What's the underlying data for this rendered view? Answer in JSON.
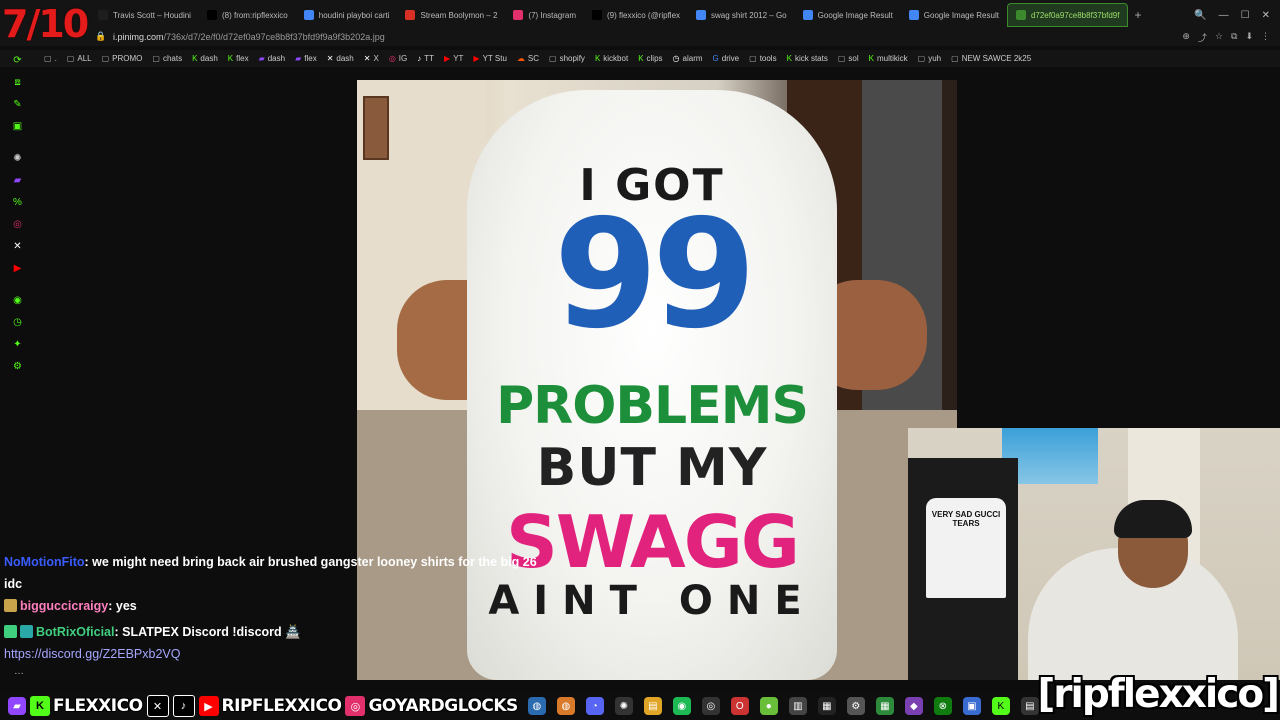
{
  "overlay": {
    "score": "7/10",
    "brand": "[ripflexxico]"
  },
  "tabs": [
    {
      "label": "Travis Scott – Houdini",
      "color": "#1e1e1e"
    },
    {
      "label": "(8) from:ripflexxico",
      "color": "#000000"
    },
    {
      "label": "houdini playboi carti",
      "color": "#4285f4"
    },
    {
      "label": "Stream Boolymon – 2",
      "color": "#d93025"
    },
    {
      "label": "(7) Instagram",
      "color": "#e1306c"
    },
    {
      "label": "(9) flexxico (@ripflex",
      "color": "#000000"
    },
    {
      "label": "swag shirt 2012 – Go",
      "color": "#4285f4"
    },
    {
      "label": "Google Image Result",
      "color": "#4285f4"
    },
    {
      "label": "Google Image Result",
      "color": "#4285f4"
    },
    {
      "label": "d72ef0a97ce8b8f37bfd9f",
      "color": "#3c8a2b",
      "active": true
    }
  ],
  "address": {
    "domain": "i.pinimg.com",
    "path": "/736x/d7/2e/f0/d72ef0a97ce8b8f37bfd9f9a9f3b202a.jpg"
  },
  "bookmarks": [
    {
      "label": ".",
      "icon": "folder"
    },
    {
      "label": "ALL",
      "icon": "folder"
    },
    {
      "label": "PROMO",
      "icon": "folder"
    },
    {
      "label": "chats",
      "icon": "folder"
    },
    {
      "label": "dash",
      "icon": "kick"
    },
    {
      "label": "flex",
      "icon": "kick"
    },
    {
      "label": "dash",
      "icon": "twitch"
    },
    {
      "label": "flex",
      "icon": "twitch"
    },
    {
      "label": "dash",
      "icon": "x"
    },
    {
      "label": "X",
      "icon": "x"
    },
    {
      "label": "IG",
      "icon": "instagram"
    },
    {
      "label": "TT",
      "icon": "tiktok"
    },
    {
      "label": "YT",
      "icon": "youtube"
    },
    {
      "label": "YT Stu",
      "icon": "youtube"
    },
    {
      "label": "SC",
      "icon": "soundcloud"
    },
    {
      "label": "shopify",
      "icon": "folder"
    },
    {
      "label": "kickbot",
      "icon": "kick"
    },
    {
      "label": "clips",
      "icon": "kick"
    },
    {
      "label": "alarm",
      "icon": "clock"
    },
    {
      "label": "drive",
      "icon": "google"
    },
    {
      "label": "tools",
      "icon": "folder"
    },
    {
      "label": "kick stats",
      "icon": "kick"
    },
    {
      "label": "sol",
      "icon": "folder"
    },
    {
      "label": "multikick",
      "icon": "kick"
    },
    {
      "label": "yuh",
      "icon": "folder"
    },
    {
      "label": "NEW SAWCE 2k25",
      "icon": "folder"
    }
  ],
  "shirt": {
    "line1": "I GOT",
    "line2": "99",
    "line3": "PROBLEMS",
    "line4": "BUT MY",
    "line5": "SWAGG",
    "line6": "AINT ONE"
  },
  "webcam": {
    "tee_text": "VERY SAD GUCCI TEARS"
  },
  "chat": [
    {
      "user": "NoMotionFito",
      "text": ": we might need bring back air brushed gangster looney shirts for the big 26 idc"
    },
    {
      "user": "bigguccicraigy",
      "text": ": yes"
    },
    {
      "user": "BotRixOficial",
      "text": ": SLATPEX Discord !discord 🏯"
    },
    {
      "user": "",
      "text": "https://discord.gg/Z2EBPxb2VQ"
    }
  ],
  "handles": [
    {
      "platform": "kick",
      "name": "FLEXXICO",
      "color": "#53fc18"
    },
    {
      "platform": "x",
      "name": "",
      "color": "#000000"
    },
    {
      "platform": "tiktok",
      "name": "",
      "color": "#000000"
    },
    {
      "platform": "youtube",
      "name": "RIPFLEXXICO",
      "color": "#ff0000"
    },
    {
      "platform": "instagram",
      "name": "GOYARDGLOCKS",
      "color": "#e1306c"
    }
  ],
  "colors": {
    "accent": "#53fc18",
    "score": "#e41b1b",
    "pink": "#e2237d",
    "blue": "#1f5fb8",
    "green": "#1d8f3a"
  }
}
